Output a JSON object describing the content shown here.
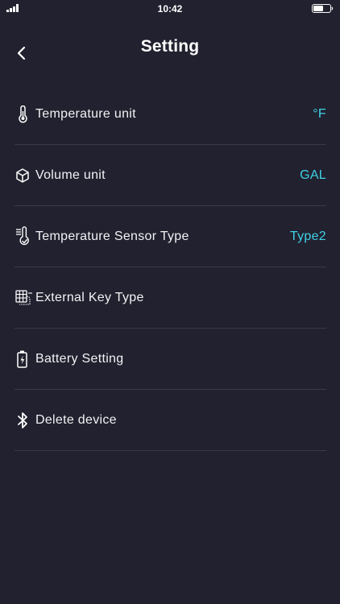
{
  "status_bar": {
    "time": "10:42"
  },
  "header": {
    "title": "Setting"
  },
  "settings": [
    {
      "label": "Temperature unit",
      "value": "°F",
      "icon": "thermometer-icon"
    },
    {
      "label": "Volume unit",
      "value": "GAL",
      "icon": "cube-icon"
    },
    {
      "label": "Temperature Sensor Type",
      "value": "Type2",
      "icon": "temperature-sensor-icon"
    },
    {
      "label": "External Key Type",
      "value": "",
      "icon": "keypad-icon"
    },
    {
      "label": "Battery Setting",
      "value": "",
      "icon": "battery-icon"
    },
    {
      "label": "Delete device",
      "value": "",
      "icon": "bluetooth-icon"
    }
  ],
  "colors": {
    "background": "#22212f",
    "accent": "#3fd2e6",
    "divider": "#3a3948"
  }
}
